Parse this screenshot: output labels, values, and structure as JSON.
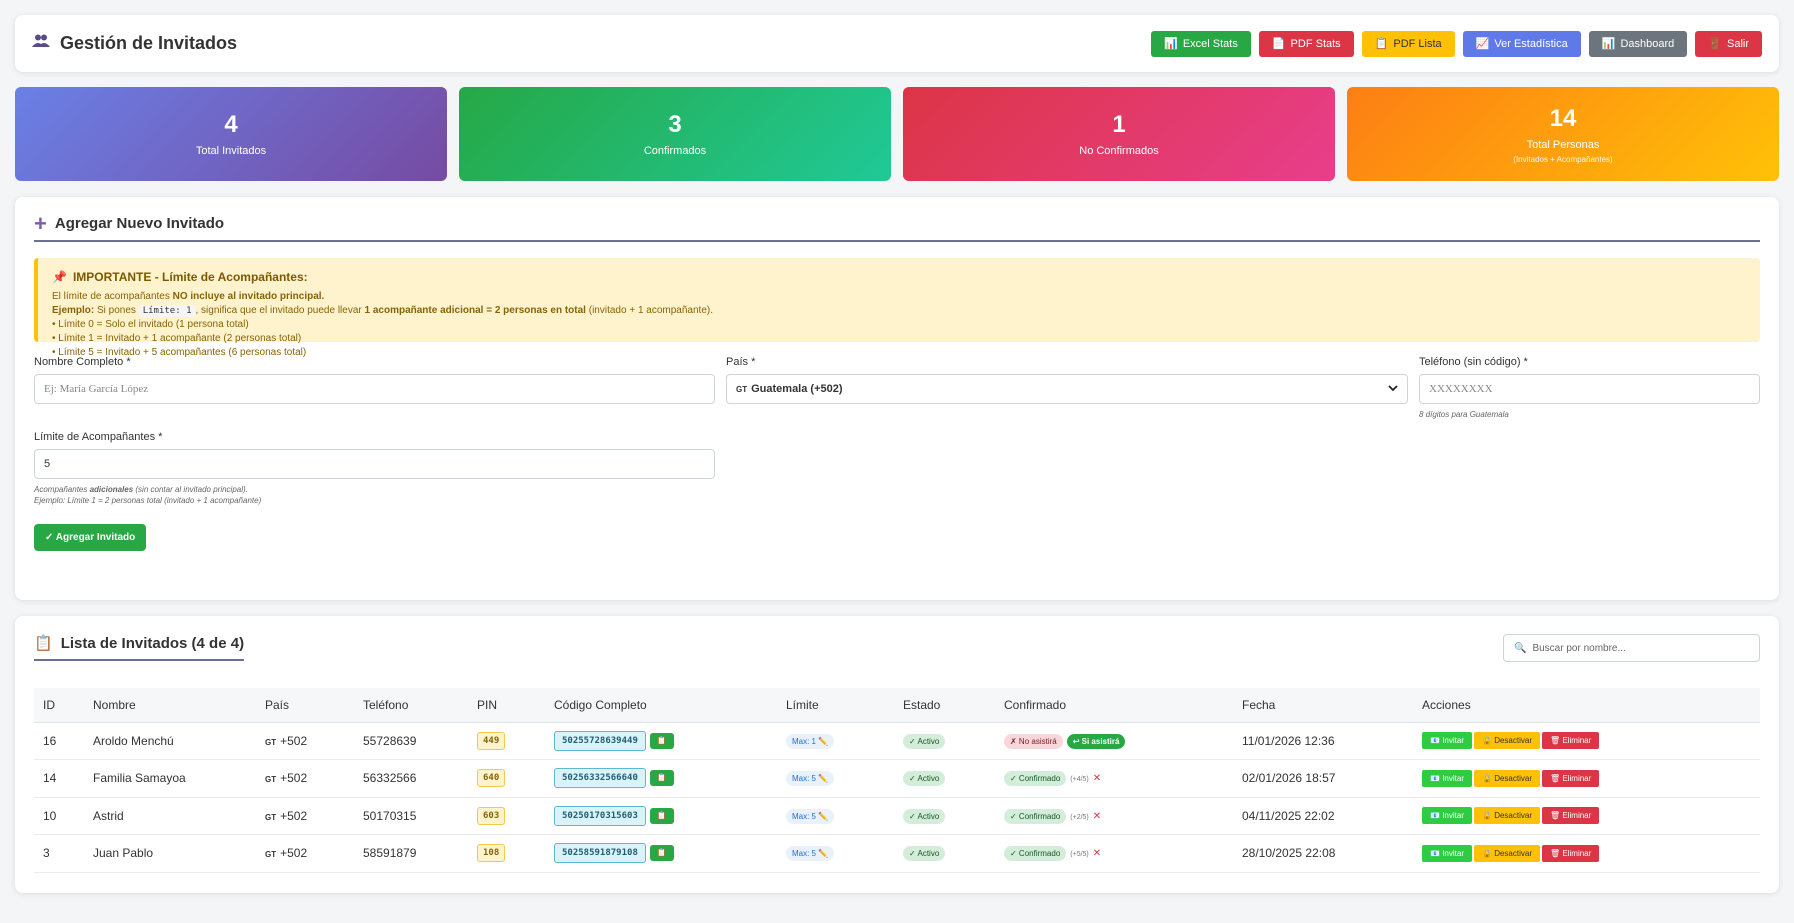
{
  "header": {
    "title": "Gestión de Invitados",
    "icon": "people-icon",
    "buttons": {
      "excel": "Excel Stats",
      "pdf_stats": "PDF Stats",
      "pdf_lista": "PDF Lista",
      "ver_estadistica": "Ver Estadística",
      "dashboard": "Dashboard",
      "salir": "Salir"
    }
  },
  "stats": {
    "total": {
      "value": "4",
      "label": "Total Invitados"
    },
    "confirmados": {
      "value": "3",
      "label": "Confirmados"
    },
    "no_confirmados": {
      "value": "1",
      "label": "No Confirmados"
    },
    "personas": {
      "value": "14",
      "label": "Total Personas",
      "sub": "(Invitados + Acompañantes)"
    }
  },
  "form": {
    "title": "Agregar Nuevo Invitado",
    "notice": {
      "title": "IMPORTANTE - Límite de Acompañantes:",
      "line1_pre": "El límite de acompañantes ",
      "line1_bold": "NO incluye al invitado principal.",
      "ex_label": "Ejemplo:",
      "ex_pre": " Si pones ",
      "ex_code": "Límite: 1",
      "ex_mid": ", significa que el invitado puede llevar ",
      "ex_bold": "1 acompañante adicional = 2 personas en total",
      "ex_post": " (invitado + 1 acompañante).",
      "b0": "• Límite 0 = Solo el invitado (1 persona total)",
      "b1": "• Límite 1 = Invitado + 1 acompañante (2 personas total)",
      "b5": "• Límite 5 = Invitado + 5 acompañantes (6 personas total)"
    },
    "nombre": {
      "label": "Nombre Completo *",
      "placeholder": "Ej: María García López"
    },
    "pais": {
      "label": "País *",
      "flag": "GT",
      "value": "Guatemala (+502)"
    },
    "telefono": {
      "label": "Teléfono (sin código) *",
      "placeholder": "XXXXXXXX",
      "hint": "8 dígitos para Guatemala"
    },
    "limite": {
      "label": "Límite de Acompañantes *",
      "value": "5",
      "hint1_pre": "Acompañantes ",
      "hint1_bold": "adicionales",
      "hint1_post": " (sin contar al invitado principal).",
      "hint2": "Ejemplo: Límite 1 = 2 personas total (invitado + 1 acompañante)"
    },
    "submit": "✓ Agregar Invitado"
  },
  "list": {
    "title": "Lista de Invitados (4 de 4)",
    "search_placeholder": "Buscar por nombre...",
    "columns": [
      "ID",
      "Nombre",
      "País",
      "Teléfono",
      "PIN",
      "Código Completo",
      "Límite",
      "Estado",
      "Confirmado",
      "Fecha",
      "Acciones"
    ],
    "rows": [
      {
        "id": "16",
        "nombre": "Aroldo Menchú",
        "flag": "GT",
        "pais": "+502",
        "telefono": "55728639",
        "pin": "449",
        "codigo": "50255728639449",
        "limite": "Max: 1",
        "estado": "✓ Activo",
        "confirmado": "✗ No asistirá",
        "confirmado_extra": "↩ Si asistirá",
        "fecha": "11/01/2026 12:36"
      },
      {
        "id": "14",
        "nombre": "Familia Samayoa",
        "flag": "GT",
        "pais": "+502",
        "telefono": "56332566",
        "pin": "640",
        "codigo": "50256332566640",
        "limite": "Max: 5",
        "estado": "✓ Activo",
        "confirmado": "✓ Confirmado",
        "confirmado_extra": "(+4/5)",
        "fecha": "02/01/2026 18:57"
      },
      {
        "id": "10",
        "nombre": "Astrid",
        "flag": "GT",
        "pais": "+502",
        "telefono": "50170315",
        "pin": "603",
        "codigo": "50250170315603",
        "limite": "Max: 5",
        "estado": "✓ Activo",
        "confirmado": "✓ Confirmado",
        "confirmado_extra": "(+2/5)",
        "fecha": "04/11/2025 22:02"
      },
      {
        "id": "3",
        "nombre": "Juan Pablo",
        "flag": "GT",
        "pais": "+502",
        "telefono": "58591879",
        "pin": "108",
        "codigo": "50258591879108",
        "limite": "Max: 5",
        "estado": "✓ Activo",
        "confirmado": "✓ Confirmado",
        "confirmado_extra": "(+5/5)",
        "fecha": "28/10/2025 22:08"
      }
    ],
    "actions": {
      "invitar": "Invitar",
      "desactivar": "Desactivar",
      "eliminar": "Eliminar"
    }
  },
  "colors": {
    "accent": "#28a745",
    "danger": "#dc3545",
    "warning": "#ffc107",
    "primary": "#5f7ae8"
  }
}
